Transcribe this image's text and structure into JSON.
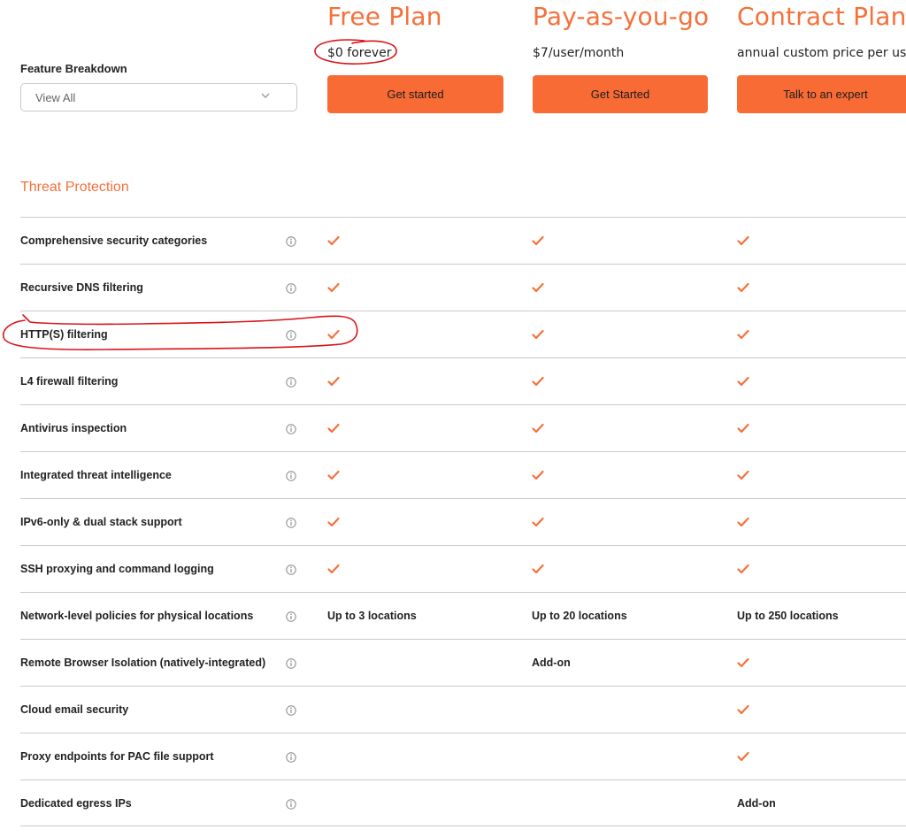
{
  "plans": [
    {
      "title": "Free Plan",
      "price": "$0 forever",
      "cta": "Get started"
    },
    {
      "title": "Pay-as-you-go",
      "price": "$7/user/month",
      "cta": "Get Started"
    },
    {
      "title": "Contract Plan",
      "price": "annual custom price per user",
      "cta": "Talk to an expert"
    }
  ],
  "feature_breakdown": {
    "label": "Feature Breakdown",
    "select_value": "View All"
  },
  "section_title": "Threat Protection",
  "rows": [
    {
      "label": "Comprehensive security categories",
      "cells": [
        "check",
        "check",
        "check"
      ]
    },
    {
      "label": "Recursive DNS filtering",
      "cells": [
        "check",
        "check",
        "check"
      ]
    },
    {
      "label": "HTTP(S) filtering",
      "cells": [
        "check",
        "check",
        "check"
      ]
    },
    {
      "label": "L4 firewall filtering",
      "cells": [
        "check",
        "check",
        "check"
      ]
    },
    {
      "label": "Antivirus inspection",
      "cells": [
        "check",
        "check",
        "check"
      ]
    },
    {
      "label": "Integrated threat intelligence",
      "cells": [
        "check",
        "check",
        "check"
      ]
    },
    {
      "label": "IPv6-only & dual stack support",
      "cells": [
        "check",
        "check",
        "check"
      ]
    },
    {
      "label": "SSH proxying and command logging",
      "cells": [
        "check",
        "check",
        "check"
      ]
    },
    {
      "label": "Network-level policies for physical locations",
      "cells": [
        "Up to 3 locations",
        "Up to 20 locations",
        "Up to 250 locations"
      ]
    },
    {
      "label": "Remote Browser Isolation (natively-integrated)",
      "cells": [
        "",
        "Add-on",
        "check"
      ]
    },
    {
      "label": "Cloud email security",
      "cells": [
        "",
        "",
        "check"
      ]
    },
    {
      "label": "Proxy endpoints for PAC file support",
      "cells": [
        "",
        "",
        "check"
      ]
    },
    {
      "label": "Dedicated egress IPs",
      "cells": [
        "",
        "",
        "Add-on"
      ]
    }
  ],
  "colors": {
    "accent": "#f6703a",
    "button": "#f86b35",
    "annotation": "#d9141b"
  },
  "icons": {
    "check": "check-icon",
    "info": "info-icon",
    "dropdown": "chevron-down-icon"
  }
}
